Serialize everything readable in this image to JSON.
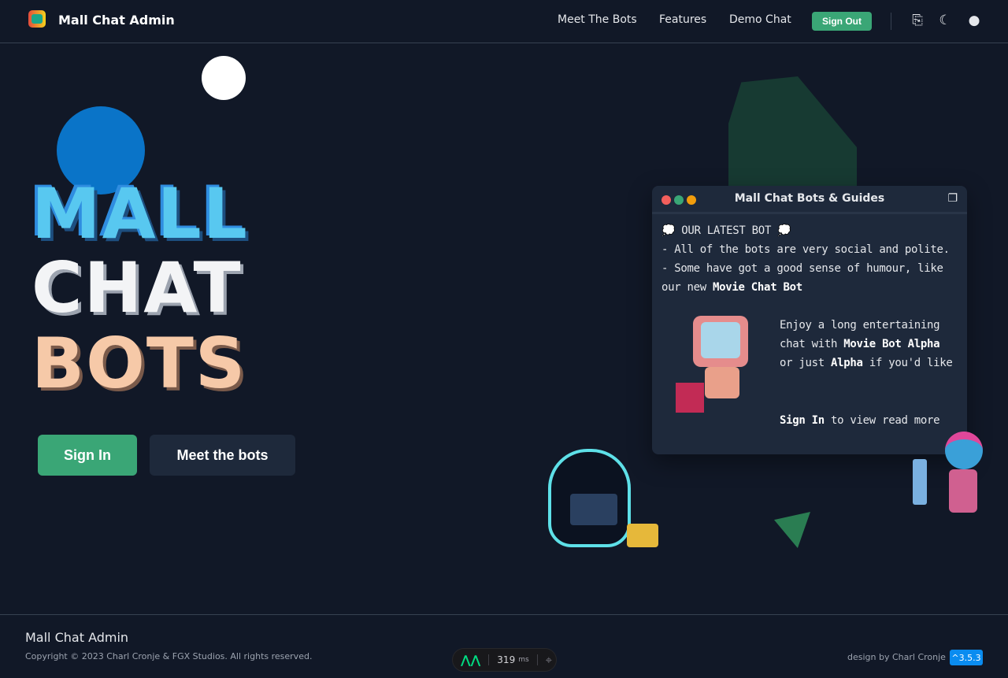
{
  "header": {
    "brand": "Mall Chat Admin",
    "nav": [
      "Meet The Bots",
      "Features",
      "Demo Chat"
    ],
    "sign_out": "Sign Out"
  },
  "hero": {
    "line1": "MALL",
    "line2": "CHAT",
    "line3": "BOTS",
    "sign_in": "Sign In",
    "meet": "Meet the bots"
  },
  "terminal": {
    "title": "Mall Chat Bots & Guides",
    "l1": "OUR LATEST BOT",
    "l2": "- All of the bots are very social and polite.",
    "l3a": "- Some have got a good sense of humour, like our new ",
    "l3b": "Movie Chat Bot",
    "p1": "Enjoy a long entertaining chat with ",
    "p1b": "Movie Bot Alpha",
    "p2": " or just ",
    "p2b": "Alpha",
    "p3": " if you'd like",
    "s1": "Sign In",
    "s2": " to view read more"
  },
  "footer": {
    "title": "Mall Chat Admin",
    "copyright": "Copyright © 2023 Charl Cronje & FGX Studios. All rights reserved.",
    "design": "design by Charl Cronje",
    "version": "^3.5.3"
  },
  "devtools": {
    "time": "319",
    "unit": "ms"
  },
  "colors": {
    "bg": "#111827",
    "accent": "#3aa676",
    "version": "#0a8cf0"
  }
}
